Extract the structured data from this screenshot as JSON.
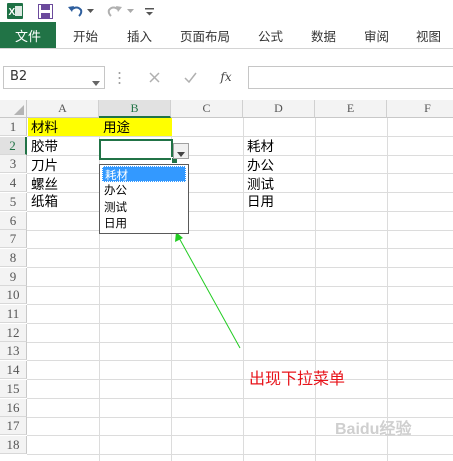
{
  "quick_access": {
    "icons": [
      "excel-icon",
      "save-icon",
      "undo-icon",
      "undo-dropdown-icon",
      "redo-icon",
      "redo-dropdown-icon",
      "customize-qat-icon"
    ]
  },
  "ribbon": {
    "file_tab": "文件",
    "tabs": [
      "开始",
      "插入",
      "页面布局",
      "公式",
      "数据",
      "审阅",
      "视图"
    ]
  },
  "formula_bar": {
    "name_box": "B2",
    "formula": ""
  },
  "sheet": {
    "columns": [
      "A",
      "B",
      "C",
      "D",
      "E",
      "F"
    ],
    "selected_column": "B",
    "rows": [
      "1",
      "2",
      "3",
      "4",
      "5",
      "6",
      "7",
      "8",
      "9",
      "10",
      "11",
      "12",
      "13",
      "14",
      "15",
      "16",
      "17",
      "18"
    ],
    "selected_row": "2",
    "cells": {
      "A1": "材料",
      "B1": "用途",
      "A2": "胶带",
      "A3": "刀片",
      "A4": "螺丝",
      "A5": "纸箱",
      "D2": "耗材",
      "D3": "办公",
      "D4": "测试",
      "D5": "日用"
    },
    "header_highlight_color": "#ffff00"
  },
  "dropdown": {
    "options": [
      "耗材",
      "办公",
      "测试",
      "日用"
    ],
    "highlighted": "耗材"
  },
  "annotation": {
    "text": "出现下拉菜单",
    "color": "#e8141b",
    "arrow_color": "#00cc00"
  },
  "watermark": {
    "text": "Baidu经验"
  }
}
